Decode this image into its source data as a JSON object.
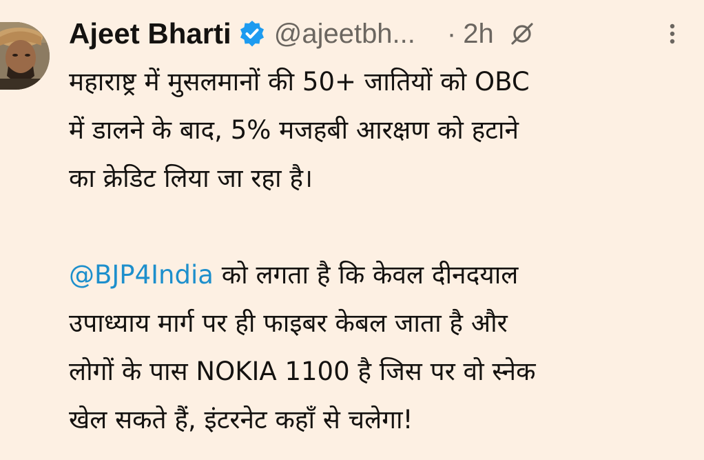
{
  "tweet": {
    "author": {
      "name": "Ajeet Bharti",
      "handle": "@ajeetbh...",
      "verified": true,
      "avatar_icon": "user-avatar-photo"
    },
    "separator": "·",
    "time": "2h",
    "icons": {
      "verified": "verified-badge-icon",
      "grok": "grok-icon",
      "more": "more-options-icon"
    },
    "colors": {
      "background": "#fdf0e3",
      "text": "#141210",
      "secondary": "#6b6660",
      "mention": "#1d8fcc",
      "verified": "#1d9bf0"
    },
    "paragraphs": [
      {
        "lines": [
          "महाराष्ट्र में मुसलमानों की 50+ जातियों को OBC",
          "में डालने के बाद, 5% मजहबी आरक्षण को हटाने",
          "का क्रेडिट लिया जा रहा है।"
        ]
      },
      {
        "mention": "@BJP4India",
        "first_line_rest": " को लगता है कि केवल दीनदयाल",
        "lines": [
          "उपाध्याय मार्ग पर ही फाइबर केबल जाता है और",
          "लोगों के पास NOKIA 1100 है जिस पर वो स्नेक",
          "खेल सकते हैं, इंटरनेट कहाँ से चलेगा!"
        ]
      }
    ]
  }
}
